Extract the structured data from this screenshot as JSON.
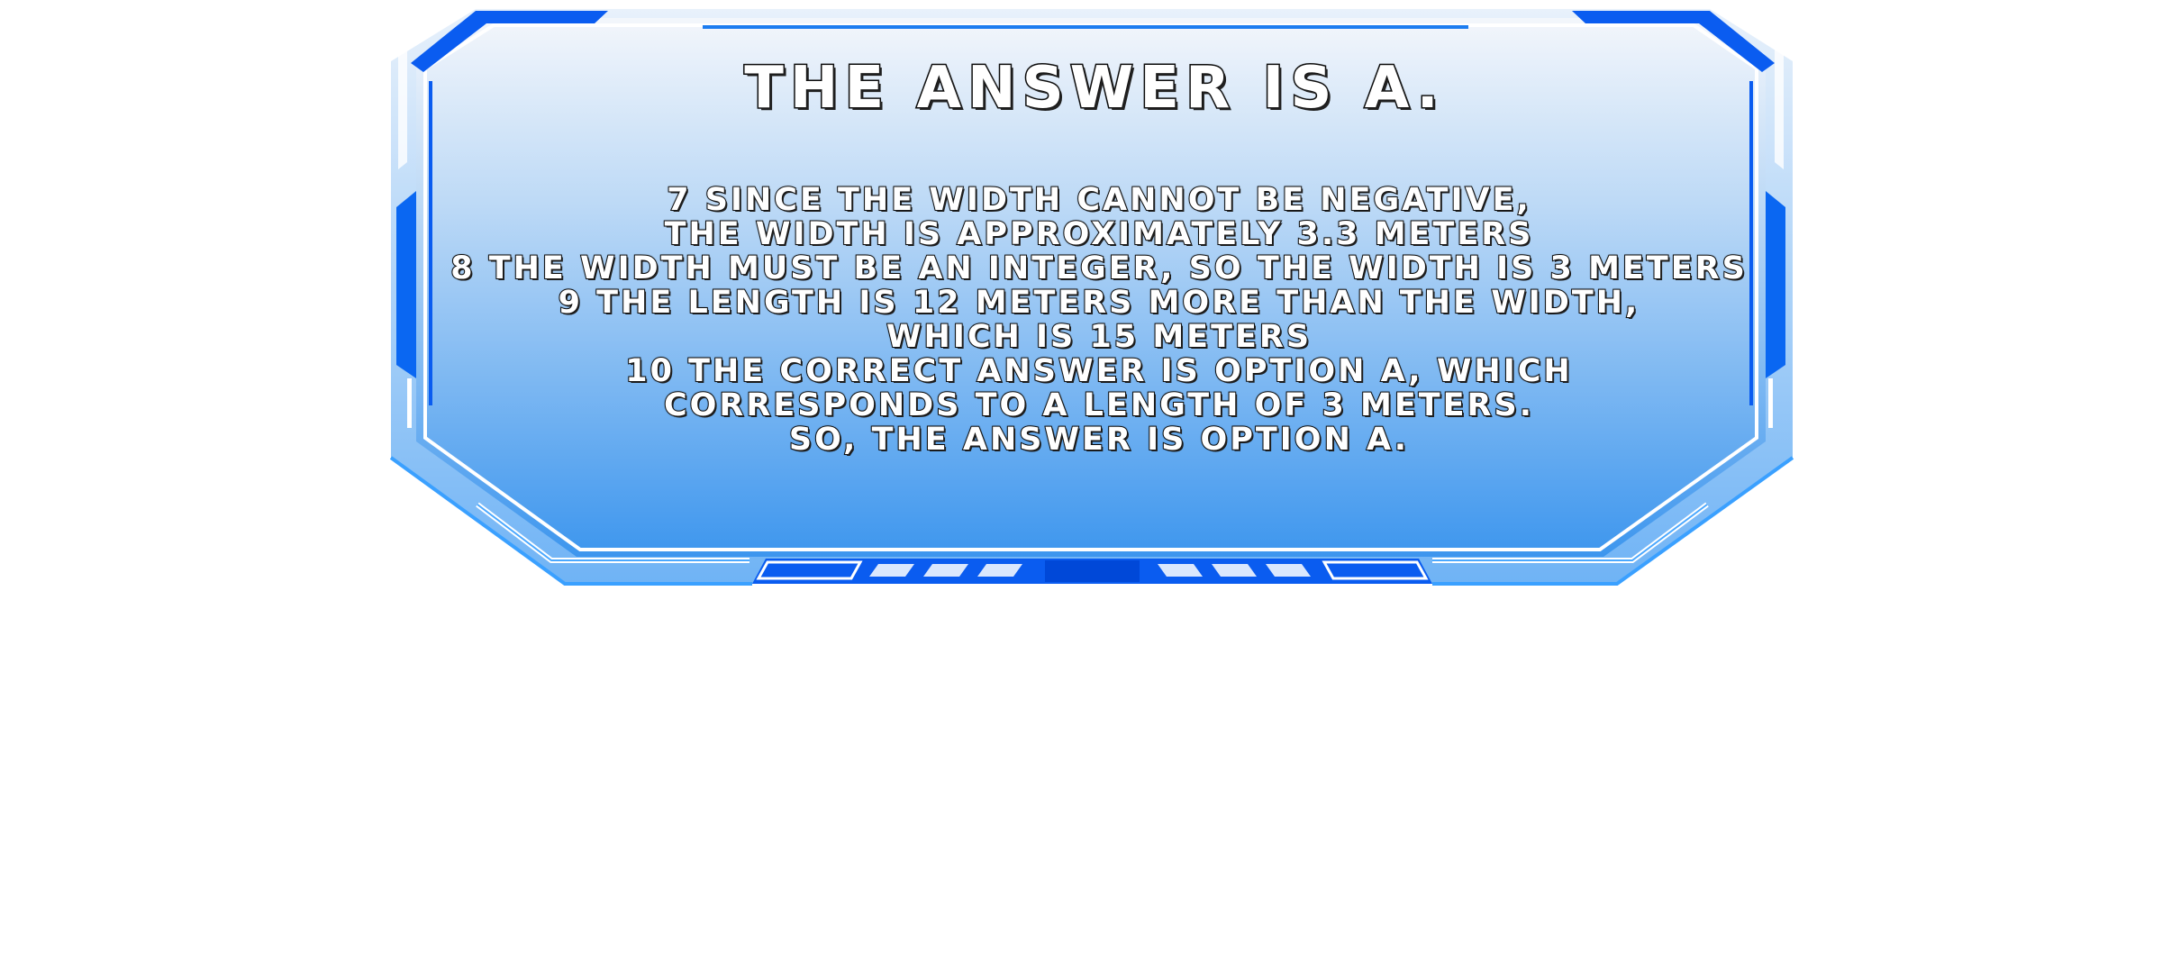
{
  "panel": {
    "title": "THE ANSWER IS A.",
    "lines": [
      "7 SINCE THE WIDTH CANNOT BE NEGATIVE,",
      "THE WIDTH IS APPROXIMATELY 3.3 METERS",
      "8 THE WIDTH MUST BE AN INTEGER, SO THE WIDTH IS 3 METERS",
      "9 THE LENGTH IS 12 METERS MORE THAN THE WIDTH,",
      "WHICH IS 15 METERS",
      "10 THE CORRECT ANSWER IS OPTION A, WHICH",
      "CORRESPONDS TO A LENGTH OF 3 METERS.",
      "SO, THE ANSWER IS OPTION A."
    ]
  },
  "colors": {
    "frame_dark_blue": "#0a5cf0",
    "frame_light_blue": "#3aa0ff",
    "panel_top": "#f2f5fb",
    "panel_bottom": "#3d98ef",
    "text_fill": "#ffffff",
    "text_outline": "#111111"
  }
}
